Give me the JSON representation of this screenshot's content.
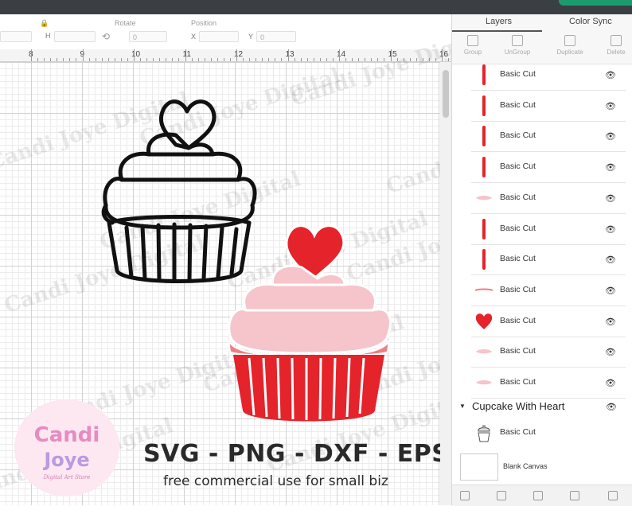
{
  "toolbar": {
    "h_label": "H",
    "rotate_label": "Rotate",
    "position_label": "Position",
    "x_label": "X",
    "y_label": "Y",
    "rotate_value": "0",
    "y_value": "0"
  },
  "ruler": {
    "numbers": [
      "8",
      "9",
      "10",
      "11",
      "12",
      "13",
      "14",
      "15",
      "16"
    ]
  },
  "panel": {
    "tabs": [
      "Layers",
      "Color Sync"
    ],
    "actions": [
      "Group",
      "UnGroup",
      "Duplicate",
      "Delete"
    ],
    "layers": [
      {
        "label": "Basic Cut",
        "thumb": "red-stripe"
      },
      {
        "label": "Basic Cut",
        "thumb": "red-stripe"
      },
      {
        "label": "Basic Cut",
        "thumb": "red-stripe"
      },
      {
        "label": "Basic Cut",
        "thumb": "red-stripe"
      },
      {
        "label": "Basic Cut",
        "thumb": "pink-swirl"
      },
      {
        "label": "Basic Cut",
        "thumb": "red-stripe"
      },
      {
        "label": "Basic Cut",
        "thumb": "red-stripe"
      },
      {
        "label": "Basic Cut",
        "thumb": "pink-line"
      },
      {
        "label": "Basic Cut",
        "thumb": "red-heart"
      },
      {
        "label": "Basic Cut",
        "thumb": "pink-swirl"
      },
      {
        "label": "Basic Cut",
        "thumb": "pink-swirl"
      }
    ],
    "group_name": "Cupcake With Heart",
    "group_child_label": "Basic Cut",
    "blank_canvas_label": "Blank Canvas"
  },
  "watermark": "Candi Joye Digital",
  "logo": {
    "line1": "Candi",
    "line2": "Joye",
    "line3": "Digital Art Store"
  },
  "overlay": {
    "formats": "SVG - PNG - DXF - EPS",
    "tagline": "free commercial use for small biz"
  },
  "colors": {
    "cupcake_red": "#e5232b",
    "frosting_pink": "#f6c4cb",
    "liner_accent": "#f07d84",
    "heart_red": "#e5232b",
    "topbar": "#3a3f44"
  }
}
